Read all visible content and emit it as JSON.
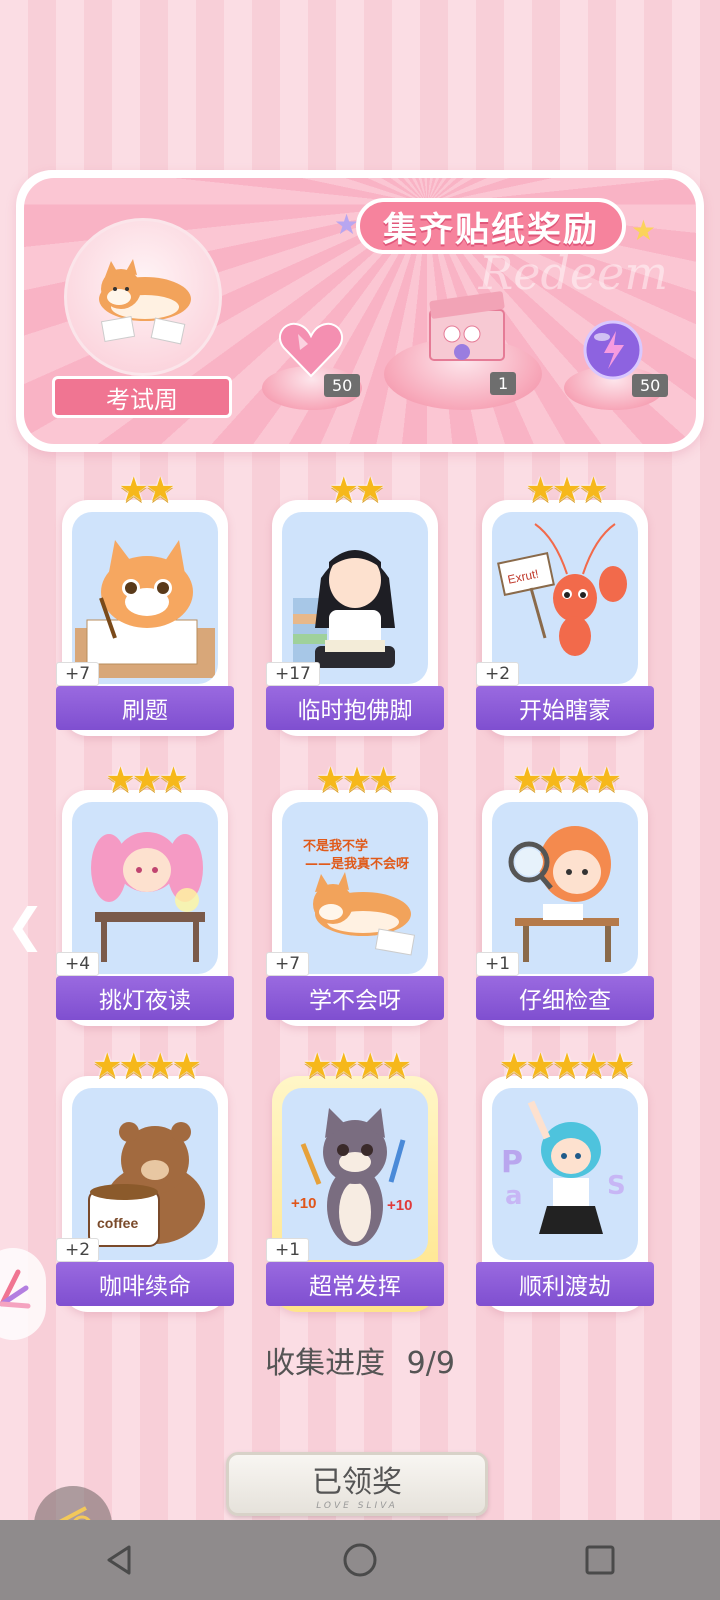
{
  "banner": {
    "title": "集齐贴纸奖励",
    "watermark": "Redeem",
    "topic_label": "考试周",
    "rewards": [
      {
        "name": "heart-gem",
        "count": "50"
      },
      {
        "name": "gift-box",
        "count": "1"
      },
      {
        "name": "purple-orb",
        "count": "50"
      }
    ]
  },
  "cards": [
    {
      "label": "刷题",
      "badge": "+7",
      "stars": "★★",
      "theme": "cat-writing"
    },
    {
      "label": "临时抱佛脚",
      "badge": "+17",
      "stars": "★★",
      "theme": "girl-reading"
    },
    {
      "label": "开始瞎蒙",
      "badge": "+2",
      "stars": "★★★",
      "theme": "lobster",
      "sign": "Exrut!"
    },
    {
      "label": "挑灯夜读",
      "badge": "+4",
      "stars": "★★★",
      "theme": "pink-girl"
    },
    {
      "label": "学不会呀",
      "badge": "+7",
      "stars": "★★★",
      "theme": "shiba",
      "caption_1": "不是我不学",
      "caption_2": "——是我真不会呀"
    },
    {
      "label": "仔细检查",
      "badge": "+1",
      "stars": "★★★★",
      "theme": "orange-girl"
    },
    {
      "label": "咖啡续命",
      "badge": "+2",
      "stars": "★★★★",
      "theme": "bear-coffee",
      "cup_text": "coffee"
    },
    {
      "label": "超常发挥",
      "badge": "+1",
      "stars": "★★★★",
      "theme": "grey-cat",
      "bonus": "+10"
    },
    {
      "label": "顺利渡劫",
      "badge": "",
      "stars": "★★★★★",
      "theme": "blue-girl"
    }
  ],
  "progress": {
    "label": "收集进度",
    "value": "9/9"
  },
  "claim": {
    "label": "已领奖",
    "sub": "LOVE SLIVA"
  },
  "colors": {
    "accent": "#8a5bd8",
    "pink": "#f07592",
    "star": "#f6b81b"
  }
}
